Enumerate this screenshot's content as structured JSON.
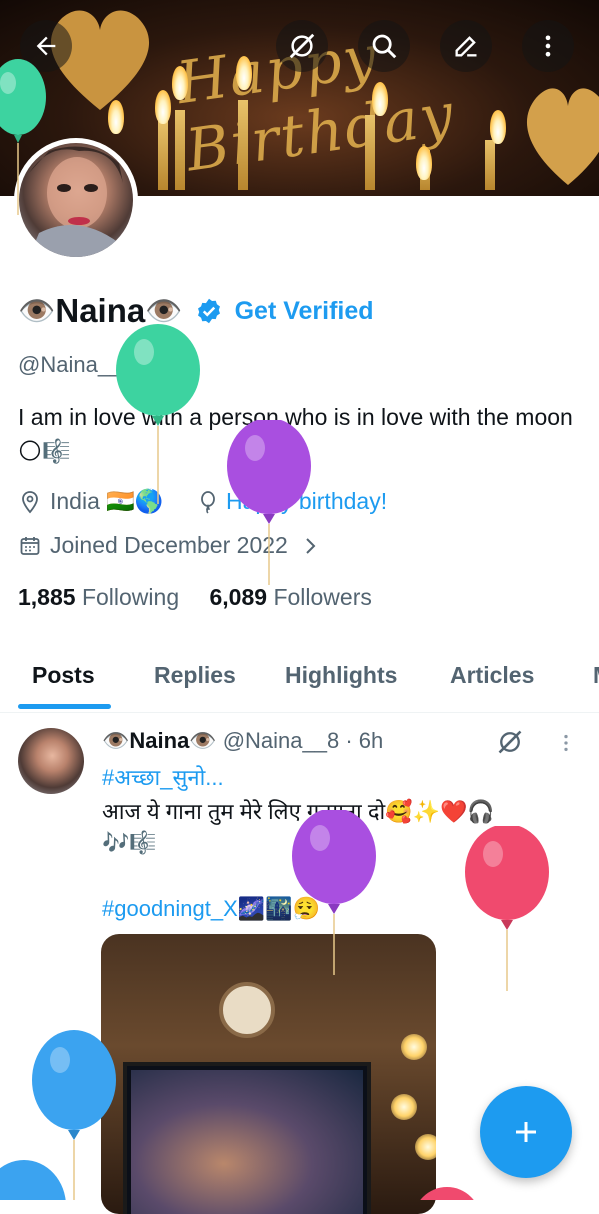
{
  "header": {
    "back_icon": "arrow-left-icon",
    "grok_icon": "slash-circle-icon",
    "search_icon": "search-icon",
    "edit_icon": "pencil-icon",
    "more_icon": "more-vertical-icon",
    "banner_alt": "Happy Birthday cake topper"
  },
  "profile": {
    "name_prefix_emoji": "👁️",
    "name": "Naina",
    "name_suffix_emoji": "👁️",
    "verified_icon": "verified-badge-icon",
    "get_verified": "Get Verified",
    "handle": "@Naina__8",
    "bio": "I am in love with a person who is in love with the moon 🌕🎼",
    "location": "India 🇮🇳🌎",
    "birthday": "Happy birthday!",
    "joined": "Joined December 2022",
    "following_count": "1,885",
    "following_label": "Following",
    "followers_count": "6,089",
    "followers_label": "Followers"
  },
  "tabs": [
    {
      "label": "Posts"
    },
    {
      "label": "Replies"
    },
    {
      "label": "Highlights"
    },
    {
      "label": "Articles"
    },
    {
      "label": "M"
    }
  ],
  "post": {
    "author_name": "👁️Naina👁️",
    "author_handle": "@Naina__8 · 6h",
    "hashtag1": "#अच्छा_सुनो...",
    "line1": " आज ये गाना तुम मेरे लिए गुनगुना दो🥰✨❤️🎧",
    "line2": "🎶🎼",
    "hashtag2": "#goodningt_X🌌🌃😮‍💨"
  },
  "fab": {
    "icon": "plus-icon"
  },
  "colors": {
    "accent": "#1d9bf0",
    "text": "#0f1419",
    "secondary": "#536471"
  }
}
